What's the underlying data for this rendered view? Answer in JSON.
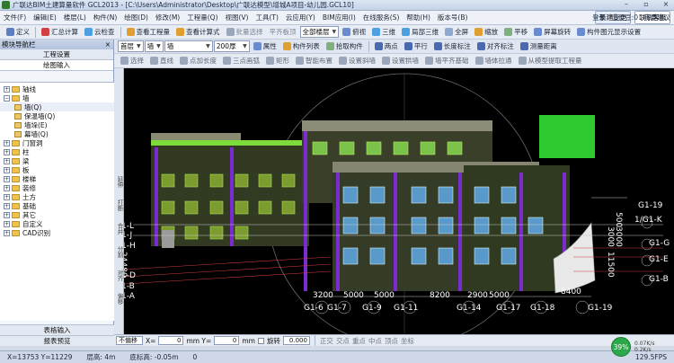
{
  "window": {
    "title": "广联达BIM土建算量软件 GCL2013 - [C:\\Users\\Administrator\\Desktop\\广联达模型\\增城A项目-幼儿园.GCL10]"
  },
  "menu": {
    "items": [
      "文件(F)",
      "编辑(E)",
      "楼层(L)",
      "构件(N)",
      "绘图(D)",
      "修改(M)",
      "工程量(Q)",
      "视图(V)",
      "工具(T)",
      "云应用(Y)",
      "BIM应用(I)",
      "在线服务(S)",
      "帮助(H)",
      "版本号(B)"
    ],
    "new_change": "新建变更",
    "service": "联系客服",
    "login": "登录",
    "cost": "造价豆:0",
    "ask": "我要建议"
  },
  "toolbar1": {
    "define": "定义",
    "summary": "汇总计算",
    "cloud_check": "云检查",
    "view_qty": "查看工程量",
    "view_formula": "查看计算式",
    "batch_select": "批量选择",
    "flat_screen": "平齐板顶",
    "floor_select": "全部楼层",
    "bird_view": "俯视",
    "three_d": "三维",
    "partial_3d": "局部三维",
    "fullscreen": "全屏",
    "zoom": "缩放",
    "pan": "平移",
    "screen_rotate": "屏幕旋转",
    "component_display": "构件图元显示设置"
  },
  "toolbar2": {
    "layer": "首层",
    "type": "墙",
    "sub_type": "墙",
    "thickness": "200厚",
    "properties": "属性",
    "component_list": "构件列表",
    "pick_component": "拾取构件",
    "two_points": "两点",
    "parallel": "平行",
    "length_label": "长度标注",
    "align_label": "对齐标注",
    "measure": "测量距离"
  },
  "toolbar3": {
    "select": "选择",
    "line": "直线",
    "point_extend": "点加长度",
    "three_point_arc": "三点画弧",
    "rectangle": "矩形",
    "smart_layout": "智能布置",
    "set_slope": "设置斜墙",
    "set_arc": "设置拱墙",
    "wall_flat": "墙平齐基础",
    "wall_pull": "墙体拉通",
    "extract_from_model": "从模型提取工程量"
  },
  "left_panel": {
    "title": "模块导航栏",
    "close": "×",
    "project_settings": "工程设置",
    "drawing_input": "绘图输入",
    "tree": [
      {
        "label": "轴线",
        "depth": 0,
        "expanded": false
      },
      {
        "label": "墙",
        "depth": 0,
        "expanded": true
      },
      {
        "label": "墙(Q)",
        "depth": 1,
        "selected": true
      },
      {
        "label": "保温墙(Q)",
        "depth": 1
      },
      {
        "label": "墙垛(E)",
        "depth": 1
      },
      {
        "label": "幕墙(Q)",
        "depth": 1
      },
      {
        "label": "门窗洞",
        "depth": 0,
        "expanded": false
      },
      {
        "label": "柱",
        "depth": 0,
        "expanded": false
      },
      {
        "label": "梁",
        "depth": 0,
        "expanded": false
      },
      {
        "label": "板",
        "depth": 0,
        "expanded": false
      },
      {
        "label": "楼梯",
        "depth": 0,
        "expanded": false
      },
      {
        "label": "装修",
        "depth": 0,
        "expanded": false
      },
      {
        "label": "土方",
        "depth": 0,
        "expanded": false
      },
      {
        "label": "基础",
        "depth": 0,
        "expanded": false
      },
      {
        "label": "其它",
        "depth": 0,
        "expanded": false
      },
      {
        "label": "自定义",
        "depth": 0,
        "expanded": false
      },
      {
        "label": "CAD识别",
        "depth": 0,
        "expanded": false
      }
    ],
    "table_input": "表格输入",
    "report_preview": "报表预览"
  },
  "side_strip": [
    "延伸",
    "打断",
    "合并",
    "分割",
    "对齐",
    "偏移"
  ],
  "canvas": {
    "axis_left": [
      "G1-L",
      "G1-J",
      "G1-H",
      "G1-D",
      "G1-B",
      "G1-A"
    ],
    "axis_right": [
      "1/G1-K",
      "G1-G",
      "G1-E",
      "G1-B"
    ],
    "axis_bottom": [
      "G1-6",
      "G1-7",
      "G1-9",
      "G1-11",
      "G1-14",
      "G1-17",
      "G1-18",
      "G1-19"
    ],
    "axis_top_right": "G1-19",
    "dims_bottom": [
      "3200",
      "5000",
      "5000",
      "8200",
      "2900",
      "5000",
      "8400"
    ],
    "dims_left": "24480",
    "dims_right": [
      "11500",
      "3000",
      "3000",
      "500"
    ]
  },
  "coord_bar": {
    "mode": "不偏移",
    "x_label": "X=",
    "x_value": "0",
    "y_label": "mm Y=",
    "y_value": "0",
    "unit": "mm",
    "rotate_label": "旋转",
    "rotate_value": "0.000",
    "snap": [
      "正交",
      "交点",
      "重点",
      "中点",
      "顶点",
      "坐标"
    ]
  },
  "status": {
    "xy": "X=13753 Y=11229",
    "floor_height": "层高: 4m",
    "base_elev": "底标高: -0.05m",
    "zero": "0",
    "fps": "129.5FPS",
    "cpu_percent": "39%",
    "net_up": "0.07K/s",
    "net_down": "0.2K/s"
  }
}
